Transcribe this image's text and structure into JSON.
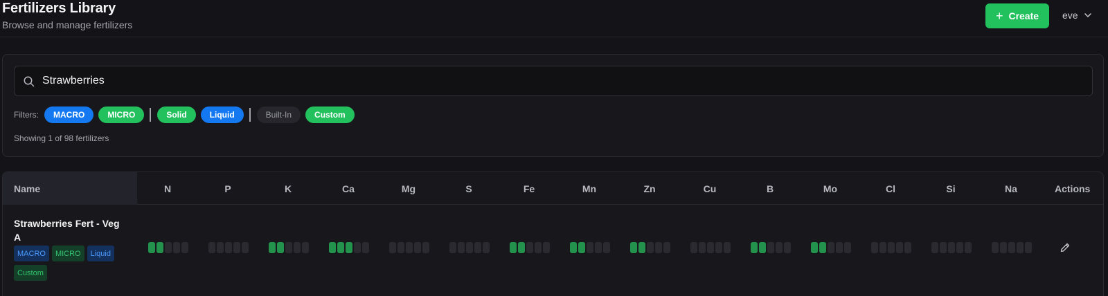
{
  "header": {
    "title": "Fertilizers Library",
    "subtitle": "Browse and manage fertilizers",
    "create_label": "Create",
    "user": "eve"
  },
  "search": {
    "value": "Strawberries"
  },
  "filters": {
    "label": "Filters:",
    "chips": [
      {
        "label": "MACRO",
        "color": "#1479f0"
      },
      {
        "label": "MICRO",
        "color": "#22c15e"
      },
      {
        "label": "Solid",
        "color": "#22c15e"
      },
      {
        "label": "Liquid",
        "color": "#1479f0"
      },
      {
        "label": "Built-In",
        "color": "#26262c"
      },
      {
        "label": "Custom",
        "color": "#22c15e"
      }
    ]
  },
  "showing": "Showing 1 of 98 fertilizers",
  "table": {
    "name_header": "Name",
    "action_header": "Actions",
    "columns": [
      "N",
      "P",
      "K",
      "Ca",
      "Mg",
      "S",
      "Fe",
      "Mn",
      "Zn",
      "Cu",
      "B",
      "Mo",
      "Cl",
      "Si",
      "Na"
    ],
    "rows": [
      {
        "name": "Strawberries Fert - Veg A",
        "tags": [
          {
            "label": "MACRO",
            "kind": "blue"
          },
          {
            "label": "MICRO",
            "kind": "green"
          },
          {
            "label": "Liquid",
            "kind": "blue"
          },
          {
            "label": "Custom",
            "kind": "green"
          }
        ],
        "levels": [
          2,
          0,
          2,
          3,
          0,
          0,
          2,
          2,
          2,
          0,
          2,
          2,
          0,
          0,
          0
        ],
        "max_level": 5
      }
    ]
  },
  "colors": {
    "accent_green": "#22c15e",
    "accent_blue": "#1479f0",
    "bar_on": "#23924d",
    "bar_off": "#2a2a30"
  }
}
